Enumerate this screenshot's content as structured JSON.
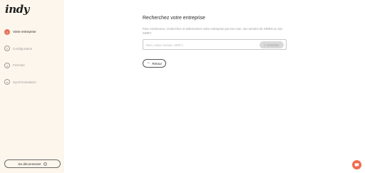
{
  "app": {
    "logo_text": "indy"
  },
  "sidebar": {
    "steps": [
      {
        "number": "1",
        "label": "Votre entreprise",
        "active": true
      },
      {
        "number": "2",
        "label": "Configuration",
        "active": false
      },
      {
        "number": "3",
        "label": "Formule",
        "active": false
      },
      {
        "number": "4",
        "label": "Synchronisation",
        "active": false
      }
    ],
    "logout_label": "Se déconnecter",
    "logout_help_icon": "question-icon"
  },
  "main": {
    "title": "Recherchez votre entreprise",
    "subtitle": "Pour commencer, recherchez et sélectionnez votre entreprise par son nom, son numéro de SIREN ou son SIRET.",
    "search": {
      "placeholder": "Nom, raison sociale, SIRET...",
      "value": "",
      "button_label": "Chercher",
      "button_icon": "search-icon"
    },
    "back_label": "Retour",
    "back_icon": "arrow-left-icon"
  },
  "chat": {
    "icon": "chat-icon"
  },
  "colors": {
    "accent": "#e8735f",
    "sidebar_bg": "#fdf6ec",
    "chat": "#f06b4f"
  }
}
